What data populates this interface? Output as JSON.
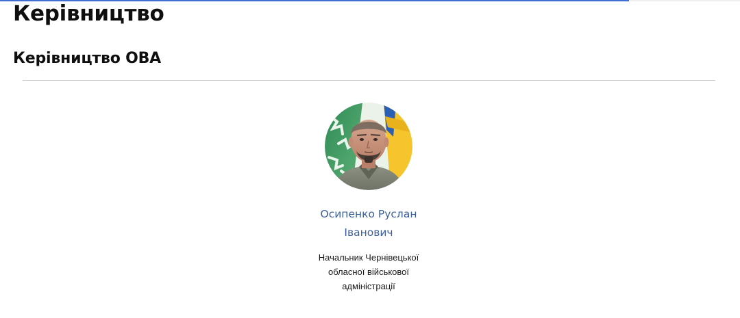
{
  "header": {
    "page_title": "Керівництво",
    "section_title": "Керівництво ОВА"
  },
  "loading_progress": 0.85,
  "leader": {
    "name": "Осипенко Руслан Іванович",
    "position": "Начальник Чернівецької обласної військової адміністрації",
    "photo": "portrait-photo"
  },
  "colors": {
    "name_link": "#3b5f9a",
    "progress_bar": "#3d6fd6",
    "divider": "#c9c9c9",
    "text": "#0f0f0f"
  }
}
